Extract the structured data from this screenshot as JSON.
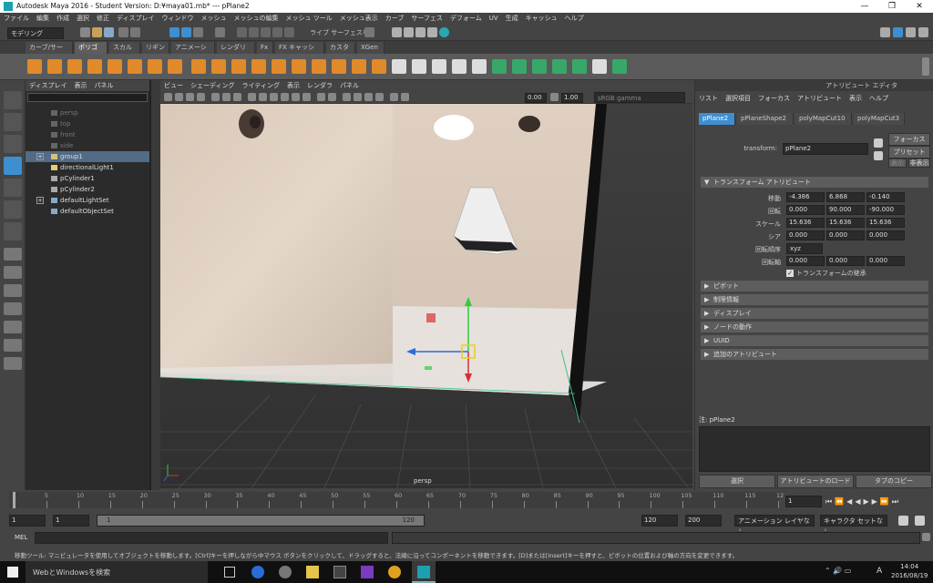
{
  "window": {
    "title": "Autodesk Maya 2016 - Student Version: D:¥maya01.mb*   ---   pPlane2",
    "minimize": "—",
    "maximize": "❐",
    "close": "✕"
  },
  "menubar": [
    "ファイル",
    "編集",
    "作成",
    "選択",
    "修正",
    "ディスプレイ",
    "ウィンドウ",
    "メッシュ",
    "メッシュの編集",
    "メッシュ ツール",
    "メッシュ表示",
    "カーブ",
    "サーフェス",
    "デフォーム",
    "UV",
    "生成",
    "キャッシュ",
    "ヘルプ"
  ],
  "statusline": {
    "mode": "モデリング",
    "live_label": "ライブ サーフェスなし"
  },
  "shelf_tabs": [
    "カーブ/サーフェス",
    "ポリゴン",
    "スカルプト",
    "リギング",
    "アニメーション",
    "レンダリング",
    "Fx",
    "FX キャッシング",
    "カスタム",
    "XGen"
  ],
  "shelf_active": "ポリゴン",
  "outliner": {
    "menu": [
      "ディスプレイ",
      "表示",
      "パネル"
    ],
    "items": [
      {
        "label": "persp",
        "dim": true,
        "plus": false,
        "icon": "camera-icon"
      },
      {
        "label": "top",
        "dim": true,
        "plus": false,
        "icon": "camera-icon"
      },
      {
        "label": "front",
        "dim": true,
        "plus": false,
        "icon": "camera-icon"
      },
      {
        "label": "side",
        "dim": true,
        "plus": false,
        "icon": "camera-icon"
      },
      {
        "label": "group1",
        "dim": false,
        "plus": true,
        "icon": "group-icon",
        "selected": true
      },
      {
        "label": "directionalLight1",
        "dim": false,
        "plus": false,
        "icon": "light-icon"
      },
      {
        "label": "pCylinder1",
        "dim": false,
        "plus": false,
        "icon": "mesh-icon"
      },
      {
        "label": "pCylinder2",
        "dim": false,
        "plus": false,
        "icon": "mesh-icon"
      },
      {
        "label": "defaultLightSet",
        "dim": false,
        "plus": true,
        "icon": "set-icon"
      },
      {
        "label": "defaultObjectSet",
        "dim": false,
        "plus": false,
        "icon": "set-icon"
      }
    ]
  },
  "viewport": {
    "menu": [
      "ビュー",
      "シェーディング",
      "ライティング",
      "表示",
      "レンダラ",
      "パネル"
    ],
    "field_a": "0.00",
    "field_b": "1.00",
    "colorspace": "sRGB gamma",
    "camera_label": "persp"
  },
  "attribute_editor": {
    "header": "アトリビュート エディタ",
    "menu": [
      "リスト",
      "選択項目",
      "フォーカス",
      "アトリビュート",
      "表示",
      "ヘルプ"
    ],
    "node_tabs": [
      "pPlane2",
      "pPlaneShape2",
      "polyMapCut10",
      "polyMapCut3"
    ],
    "transform_label": "transform:",
    "transform_value": "pPlane2",
    "focus_button": "フォーカス",
    "preset_button": "プリセット",
    "show_button": "表示",
    "hide_button": "非表示",
    "section_transform": "トランスフォーム アトリビュート",
    "rows": [
      {
        "label": "移動",
        "values": [
          "-4.386",
          "6.868",
          "-0.140"
        ]
      },
      {
        "label": "回転",
        "values": [
          "0.000",
          "90.000",
          "-90.000"
        ]
      },
      {
        "label": "スケール",
        "values": [
          "15.636",
          "15.636",
          "15.636"
        ]
      },
      {
        "label": "シア",
        "values": [
          "0.000",
          "0.000",
          "0.000"
        ]
      }
    ],
    "rotate_order_label": "回転順序",
    "rotate_order_value": "xyz",
    "rotate_axis_label": "回転軸",
    "rotate_axis_values": [
      "0.000",
      "0.000",
      "0.000"
    ],
    "inherit_label": "トランスフォームの継承",
    "sections": [
      "ピボット",
      "制限情報",
      "ディスプレイ",
      "ノードの動作",
      "UUID",
      "追加のアトリビュート"
    ],
    "notes_label": "注: pPlane2",
    "bottom_buttons": [
      "選択",
      "アトリビュートのロード",
      "タブのコピー"
    ]
  },
  "timeline": {
    "ticks": [
      "1",
      "5",
      "10",
      "15",
      "20",
      "25",
      "30",
      "35",
      "40",
      "45",
      "50",
      "55",
      "60",
      "65",
      "70",
      "75",
      "80",
      "85",
      "90",
      "95",
      "100",
      "105",
      "110",
      "115",
      "12"
    ],
    "current_frame": "1",
    "range_start": "1",
    "range_start2": "1",
    "range_inner_start": "1",
    "range_inner_end": "120",
    "range_end": "120",
    "range_end2": "200",
    "anim_layer": "アニメーション レイヤなし",
    "char_set": "キャラクタ セットなし"
  },
  "command": {
    "label": "MEL"
  },
  "helpline": "移動ツール: マニピュレータを使用してオブジェクトを移動します。[Ctrl]キーを押しながら中マウス ボタンをクリックして、ドラッグすると、法線に沿ってコンポーネントを移動できます。[D]または[Insert]キーを押すと、ピボットの位置および軸の方向を変更できます。",
  "taskbar": {
    "search": "WebとWindowsを検索",
    "ime": "A",
    "time": "14:04",
    "date": "2016/08/19"
  }
}
